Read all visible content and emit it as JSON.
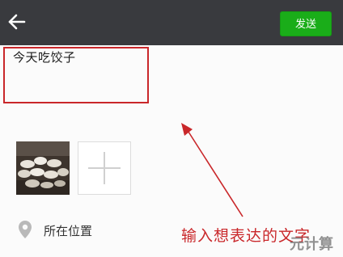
{
  "header": {
    "back_icon": "back-arrow-icon",
    "send_label": "发送",
    "accent_color": "#1aad19"
  },
  "composer": {
    "text": "今天吃饺子"
  },
  "media": {
    "thumbnail_icon": "dumplings-photo",
    "add_icon": "plus-icon"
  },
  "location": {
    "icon": "location-pin-icon",
    "label": "所在位置"
  },
  "annotation": {
    "caption": "输入想表达的文字",
    "color": "#c9272a"
  },
  "watermark": {
    "text": "元计算"
  }
}
